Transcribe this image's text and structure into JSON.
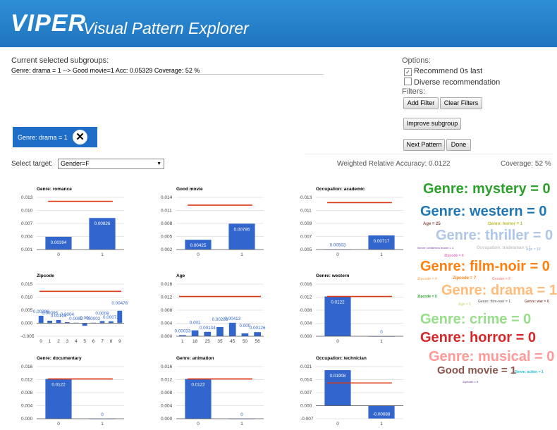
{
  "app": {
    "logo": "VIPER",
    "subtitle": "Visual Pattern Explorer"
  },
  "current": {
    "label": "Current selected subgroups:",
    "value": "Genre: drama = 1 --> Good movie=1 Acc: 0.05329 Coverage: 52 %",
    "chip": "Genre: drama = 1",
    "chip_remove": "✕"
  },
  "options": {
    "title": "Options:",
    "recommend_zeros_last": {
      "label": "Recommend 0s last",
      "checked": true,
      "mark": "✓"
    },
    "diverse_recommendation": {
      "label": "Diverse recommendation",
      "checked": false
    },
    "filters_label": "Filters:",
    "add_filter": "Add Filter",
    "clear_filters": "Clear Filters",
    "improve_subgroup": "Improve subgroup",
    "next_pattern": "Next Pattern",
    "done": "Done"
  },
  "target": {
    "label": "Select target:",
    "value": "Gender=F",
    "arrow": "▼"
  },
  "metrics": {
    "weighted_relative_accuracy": "Weighted Relative Accuracy: 0.0122",
    "coverage": "Coverage: 52 %"
  },
  "colors": {
    "bar": "#3366cc",
    "reference_line": "#dc3912",
    "header": "#2f8fd6"
  },
  "chart_data": [
    {
      "type": "bar",
      "title": "Genre: romance",
      "categories": [
        "0",
        "1"
      ],
      "values": [
        0.00394,
        0.00826
      ],
      "labels": [
        "0.00394",
        "0.00826"
      ],
      "reference": 0.0121,
      "ylim": [
        0.001,
        0.013
      ],
      "ticks": [
        0.001,
        0.004,
        0.007,
        0.01,
        0.013
      ],
      "tick_labels": [
        "0.001",
        "0.004",
        "0.007",
        "0.010",
        "0.013"
      ]
    },
    {
      "type": "bar",
      "title": "Good movie",
      "categories": [
        "0",
        "1"
      ],
      "values": [
        0.00425,
        0.00795
      ],
      "labels": [
        "0.00425",
        "0.00795"
      ],
      "reference": 0.0122,
      "ylim": [
        0.002,
        0.014
      ],
      "ticks": [
        0.002,
        0.005,
        0.008,
        0.011,
        0.014
      ],
      "tick_labels": [
        "0.002",
        "0.005",
        "0.008",
        "0.011",
        "0.014"
      ]
    },
    {
      "type": "bar",
      "title": "Occupation: academic",
      "categories": [
        "0",
        "1"
      ],
      "values": [
        0.00503,
        0.00717
      ],
      "labels": [
        "0.00503",
        "0.00717"
      ],
      "reference": 0.0122,
      "ylim": [
        0.005,
        0.013
      ],
      "ticks": [
        0.005,
        0.007,
        0.009,
        0.011,
        0.013
      ],
      "tick_labels": [
        "0.005",
        "0.007",
        "0.009",
        "0.011",
        "0.013"
      ]
    },
    {
      "type": "bar",
      "title": "Zipcode",
      "categories": [
        "0",
        "1",
        "2",
        "3",
        "4",
        "5",
        "6",
        "7",
        "8",
        "9"
      ],
      "values": [
        0.00286,
        0.00095,
        0.00124,
        0.0004,
        0.0002,
        -0.001,
        0.0002,
        0.0008,
        0.00072,
        0.00476
      ],
      "labels": [
        "0.00286",
        "0.00095",
        "0.00124",
        "0.0004",
        "0.0002",
        "-0.001",
        "0.0002",
        "0.0008",
        "0.00072",
        "0.00476"
      ],
      "reference": 0.0122,
      "ylim": [
        -0.005,
        0.015
      ],
      "ticks": [
        -0.005,
        0,
        0.005,
        0.01,
        0.015
      ],
      "tick_labels": [
        "-0.005",
        "0.000",
        "0.005",
        "0.010",
        "0.015"
      ]
    },
    {
      "type": "bar",
      "title": "Age",
      "categories": [
        "1",
        "18",
        "25",
        "35",
        "45",
        "50",
        "56"
      ],
      "values": [
        0.00033,
        0.00181,
        0.00134,
        0.00283,
        0.00413,
        0.0009,
        0.00126
      ],
      "labels": [
        "0.00033",
        "0.001",
        "0.00134",
        "0.00283",
        "0.00413",
        "0.000",
        "0.00126"
      ],
      "reference": 0.0122,
      "ylim": [
        0,
        0.016
      ],
      "ticks": [
        0,
        0.004,
        0.008,
        0.012,
        0.016
      ],
      "tick_labels": [
        "0.000",
        "0.004",
        "0.008",
        "0.012",
        "0.016"
      ]
    },
    {
      "type": "bar",
      "title": "Genre: western",
      "categories": [
        "0",
        "1"
      ],
      "values": [
        0.0122,
        0
      ],
      "labels": [
        "0.0122",
        "0"
      ],
      "reference": 0.0122,
      "ylim": [
        0,
        0.016
      ],
      "ticks": [
        0,
        0.004,
        0.008,
        0.012,
        0.016
      ],
      "tick_labels": [
        "0.000",
        "0.004",
        "0.008",
        "0.012",
        "0.016"
      ]
    },
    {
      "type": "bar",
      "title": "Genre: documentary",
      "categories": [
        "0",
        "1"
      ],
      "values": [
        0.0122,
        0
      ],
      "labels": [
        "0.0122",
        "0"
      ],
      "reference": 0.0122,
      "ylim": [
        0,
        0.016
      ],
      "ticks": [
        0,
        0.004,
        0.008,
        0.012,
        0.016
      ],
      "tick_labels": [
        "0.000",
        "0.004",
        "0.008",
        "0.012",
        "0.016"
      ]
    },
    {
      "type": "bar",
      "title": "Genre: animation",
      "categories": [
        "0",
        "1"
      ],
      "values": [
        0.0122,
        0
      ],
      "labels": [
        "0.0122",
        "0"
      ],
      "reference": 0.0122,
      "ylim": [
        0,
        0.016
      ],
      "ticks": [
        0,
        0.004,
        0.008,
        0.012,
        0.016
      ],
      "tick_labels": [
        "0.000",
        "0.004",
        "0.008",
        "0.012",
        "0.016"
      ]
    },
    {
      "type": "bar",
      "title": "Occupation: technician",
      "categories": [
        "0",
        "1"
      ],
      "values": [
        0.01908,
        -0.00688
      ],
      "labels": [
        "0.01908",
        "-0.00688"
      ],
      "reference": 0.0122,
      "ylim": [
        -0.007,
        0.021
      ],
      "ticks": [
        -0.007,
        0,
        0.007,
        0.014,
        0.021
      ],
      "tick_labels": [
        "-0.007",
        "0.000",
        "0.007",
        "0.014",
        "0.021"
      ]
    }
  ],
  "word_cloud": [
    {
      "text": "Genre: mystery = 0",
      "color": "#2ca02c",
      "size": 20
    },
    {
      "text": "Genre: western = 0",
      "color": "#1f77b4",
      "size": 20
    },
    {
      "text": "Age = 25",
      "color": "#8c564b",
      "size": 6
    },
    {
      "text": "Genre: horror = 1",
      "color": "#bcbd22",
      "size": 6
    },
    {
      "text": "Genre: thriller = 0",
      "color": "#aec7e8",
      "size": 20
    },
    {
      "text": "Genre: childrens movie = 1",
      "color": "#9467bd",
      "size": 4
    },
    {
      "text": "Occupation: tradesman = 1",
      "color": "#c7c7c7",
      "size": 6
    },
    {
      "text": "Zipcode = 0",
      "color": "#e377c2",
      "size": 5
    },
    {
      "text": "Age = 18",
      "color": "#aec7e8",
      "size": 5
    },
    {
      "text": "Genre: film-noir = 0",
      "color": "#ff7f0e",
      "size": 20
    },
    {
      "text": "Zipcode = 4",
      "color": "#ffbb78",
      "size": 5
    },
    {
      "text": "Zipcode = 7",
      "color": "#ff7f0e",
      "size": 6
    },
    {
      "text": "Gender = F",
      "color": "#ff9896",
      "size": 5
    },
    {
      "text": "Genre: drama = 1",
      "color": "#ffbb78",
      "size": 20
    },
    {
      "text": "Zipcode = 5",
      "color": "#2ca02c",
      "size": 5
    },
    {
      "text": "Age = 1",
      "color": "#dbdb8d",
      "size": 5
    },
    {
      "text": "Genre: film-noir = 1",
      "color": "#7f7f7f",
      "size": 5
    },
    {
      "text": "Genre: war = 0",
      "color": "#8c564b",
      "size": 5
    },
    {
      "text": "Genre: crime = 0",
      "color": "#98df8a",
      "size": 20
    },
    {
      "text": "Genre: horror = 0",
      "color": "#d62728",
      "size": 20
    },
    {
      "text": "Genre: musical = 0",
      "color": "#ff9896",
      "size": 20
    },
    {
      "text": "Good movie = 1",
      "color": "#8c564b",
      "size": 15
    },
    {
      "text": "Genre: action = 1",
      "color": "#17becf",
      "size": 5
    },
    {
      "text": "Zipcode = 9",
      "color": "#9467bd",
      "size": 4
    }
  ]
}
